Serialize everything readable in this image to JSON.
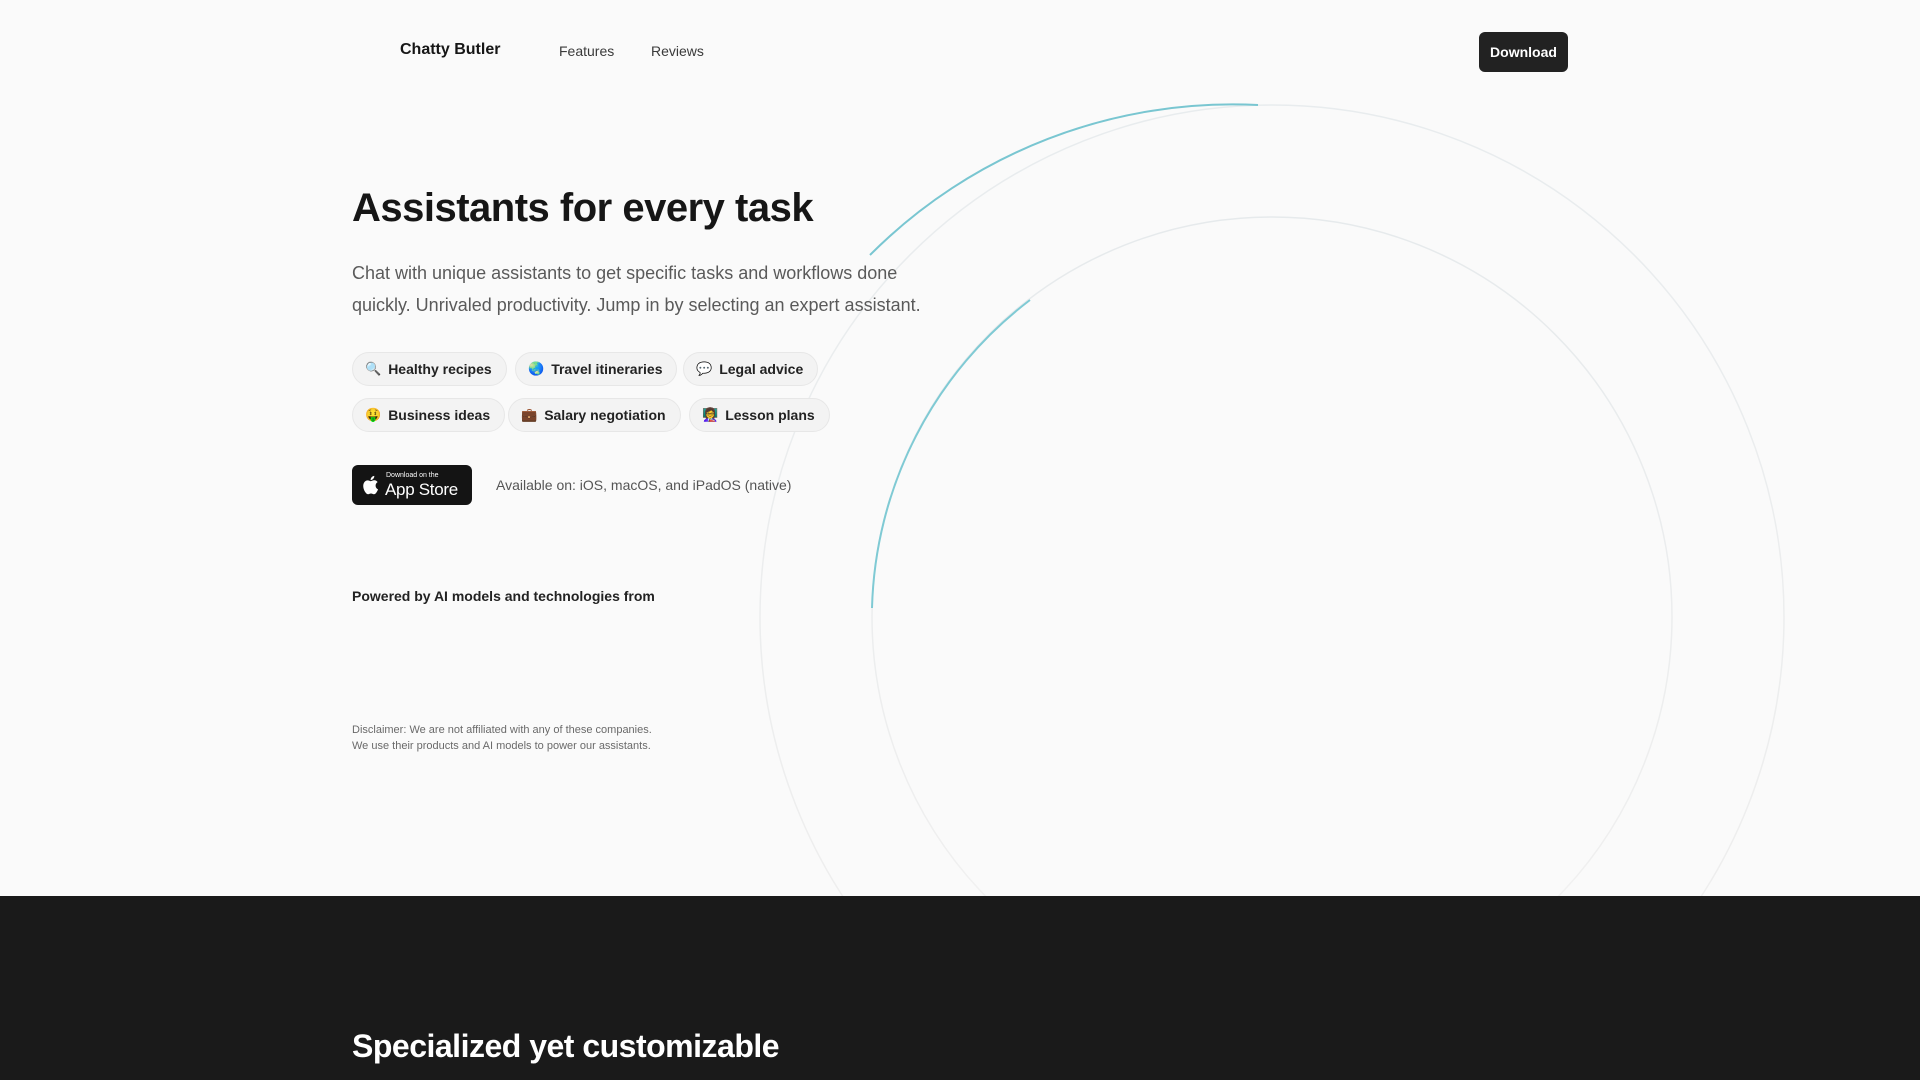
{
  "nav": {
    "brand": "Chatty Butler",
    "links": [
      "Features",
      "Reviews"
    ],
    "download_label": "Download"
  },
  "hero": {
    "title": "Assistants for every task",
    "subtitle": "Chat with unique assistants to get specific tasks and workflows done quickly. Unrivaled productivity. Jump in by selecting an expert assistant.",
    "chips": [
      {
        "icon": "🔍",
        "icon_name": "magnifier-icon",
        "label": "Healthy recipes"
      },
      {
        "icon": "🌏",
        "icon_name": "globe-icon",
        "label": "Travel itineraries"
      },
      {
        "icon": "💬",
        "icon_name": "speech-bubble-icon",
        "label": "Legal advice"
      },
      {
        "icon": "🤑",
        "icon_name": "money-face-icon",
        "label": "Business ideas"
      },
      {
        "icon": "💼",
        "icon_name": "briefcase-icon",
        "label": "Salary negotiation"
      },
      {
        "icon": "👩‍🏫",
        "icon_name": "teacher-icon",
        "label": "Lesson plans"
      }
    ],
    "appstore": {
      "small": "Download on the",
      "big": "App Store"
    },
    "available": "Available on: iOS, macOS, and iPadOS (native)",
    "powered_by": "Powered by AI models and technologies from",
    "disclaimer_line1": "Disclaimer: We are not affiliated with any of these companies.",
    "disclaimer_line2": "We use their products and AI models to power our assistants."
  },
  "section2": {
    "title": "Specialized yet customizable"
  },
  "colors": {
    "accent_arc": "#6cc4cf",
    "dark_bg": "#1a1a1a",
    "page_bg": "#fafafa"
  }
}
